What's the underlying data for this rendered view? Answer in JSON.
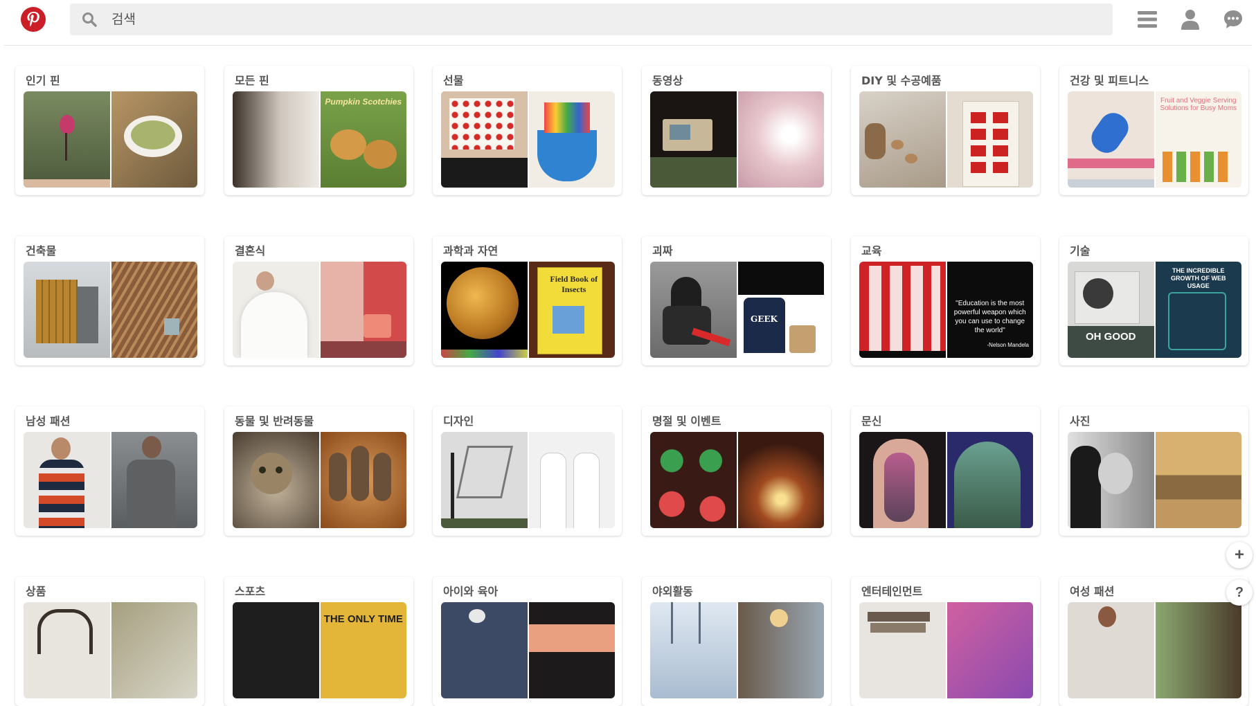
{
  "search": {
    "placeholder": "검색"
  },
  "colors": {
    "brand": "#cb1f27",
    "search_bg": "#efefef",
    "icon_gray": "#8e8e8e"
  },
  "icons": {
    "logo": "pinterest-logo",
    "search": "search-icon",
    "menu": "hamburger-icon",
    "user": "user-icon",
    "chat": "chat-icon",
    "add": "plus-icon",
    "help": "question-icon"
  },
  "floating": {
    "add_label": "+",
    "help_label": "?"
  },
  "categories": [
    {
      "label": "인기 핀",
      "colors": [
        "#5d6b4a",
        "#9a8a6a"
      ]
    },
    {
      "label": "모든 핀",
      "colors": [
        "#8c8478",
        "#7ea04b"
      ]
    },
    {
      "label": "선물",
      "colors": [
        "#c9a98a",
        "#3f8fd1"
      ]
    },
    {
      "label": "동영상",
      "colors": [
        "#2c2622",
        "#e7c6cc"
      ]
    },
    {
      "label": "DIY 및 수공예품",
      "colors": [
        "#b5a693",
        "#e3ddd2"
      ]
    },
    {
      "label": "건강 및 피트니스",
      "colors": [
        "#d9c2b0",
        "#f2ede6"
      ]
    },
    {
      "label": "건축물",
      "colors": [
        "#a1835d",
        "#7f5f45"
      ]
    },
    {
      "label": "결혼식",
      "colors": [
        "#e7e4e0",
        "#c95a55"
      ]
    },
    {
      "label": "과학과 자연",
      "colors": [
        "#9a6a25",
        "#d1a840"
      ]
    },
    {
      "label": "괴짜",
      "colors": [
        "#606060",
        "#1a1a22"
      ]
    },
    {
      "label": "교육",
      "colors": [
        "#cf2227",
        "#0c0c0c"
      ]
    },
    {
      "label": "기술",
      "colors": [
        "#a0a4a0",
        "#1c3a4e"
      ]
    },
    {
      "label": "남성 패션",
      "colors": [
        "#bf5b3a",
        "#7a7a78"
      ]
    },
    {
      "label": "동물 및 반려동물",
      "colors": [
        "#8a7560",
        "#a26a3d"
      ]
    },
    {
      "label": "디자인",
      "colors": [
        "#dcdcdc",
        "#efefef"
      ]
    },
    {
      "label": "명절 및 이벤트",
      "colors": [
        "#b94040",
        "#5a2a1a"
      ]
    },
    {
      "label": "문신",
      "colors": [
        "#3a3040",
        "#4f6a52"
      ]
    },
    {
      "label": "사진",
      "colors": [
        "#6b6b6b",
        "#b48a55"
      ]
    },
    {
      "label": "상품",
      "colors": [
        "#4a403a",
        "#a6a080"
      ]
    },
    {
      "label": "스포츠",
      "colors": [
        "#1e1e1e",
        "#e3b63a"
      ]
    },
    {
      "label": "아이와 육아",
      "colors": [
        "#3c4a66",
        "#1c1a1a"
      ]
    },
    {
      "label": "야외활동",
      "colors": [
        "#a9bcd0",
        "#7e8e9c"
      ]
    },
    {
      "label": "엔터테인먼트",
      "colors": [
        "#7a7068",
        "#b85a8e"
      ]
    },
    {
      "label": "여성 패션",
      "colors": [
        "#d6d0ca",
        "#8aa870"
      ]
    }
  ],
  "thumb_texts": {
    "moden_pin_right": "Pumpkin Scotchies",
    "science_right": "Field Book of Insects",
    "edu_right": "\"Education is the most powerful weapon which you can use to change the world\"",
    "edu_right_author": "-Nelson Mandela",
    "tech_left": "OH GOOD",
    "tech_right": "THE INCREDIBLE GROWTH OF WEB USAGE",
    "geek_right": "GEEK",
    "sports_right": "THE ONLY TIME",
    "fitness_right": "Fruit and Veggie Serving Solutions for Busy Moms"
  }
}
